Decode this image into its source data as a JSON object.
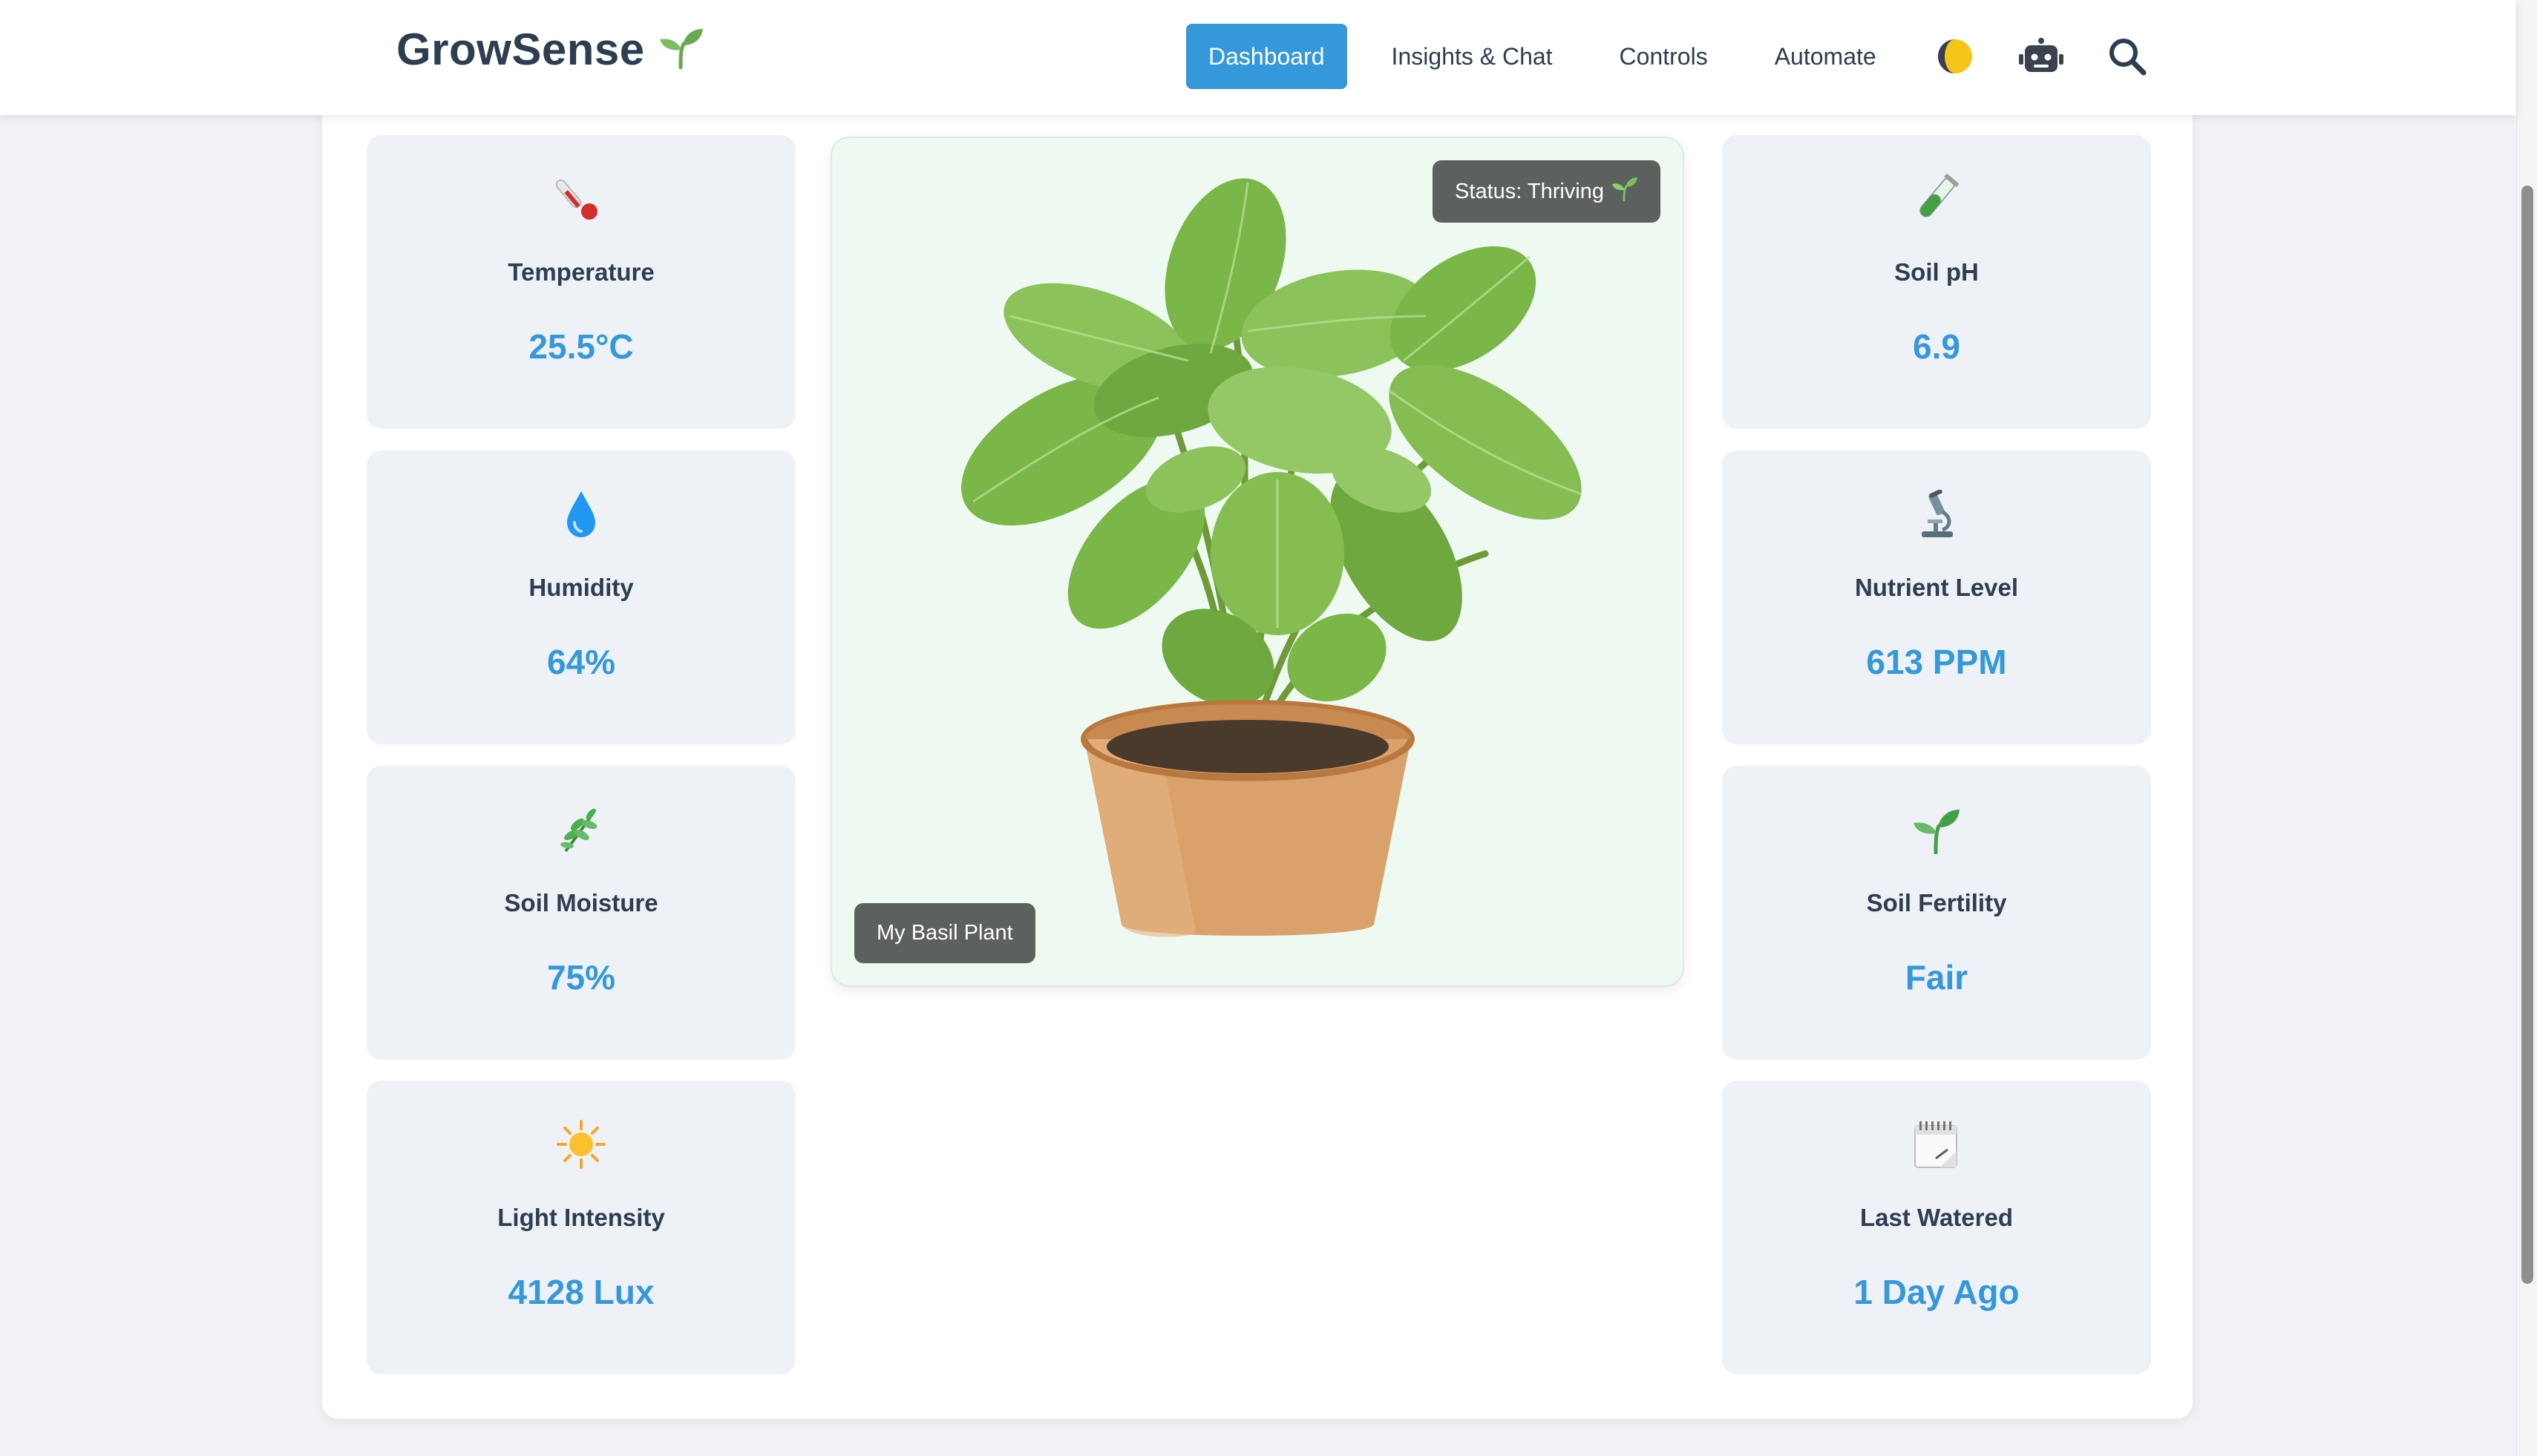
{
  "brand": {
    "name": "GrowSense"
  },
  "nav": {
    "items": [
      {
        "label": "Dashboard",
        "active": true
      },
      {
        "label": "Insights & Chat",
        "active": false
      },
      {
        "label": "Controls",
        "active": false
      },
      {
        "label": "Automate",
        "active": false
      }
    ],
    "icons": [
      "theme-toggle-icon",
      "robot-icon",
      "search-icon"
    ]
  },
  "sensors_left": [
    {
      "label": "Temperature",
      "value": "25.5°C",
      "icon": "thermometer-icon"
    },
    {
      "label": "Humidity",
      "value": "64%",
      "icon": "droplet-icon"
    },
    {
      "label": "Soil Moisture",
      "value": "75%",
      "icon": "herb-icon"
    },
    {
      "label": "Light Intensity",
      "value": "4128 Lux",
      "icon": "sun-icon"
    }
  ],
  "sensors_right": [
    {
      "label": "Soil pH",
      "value": "6.9",
      "icon": "test-tube-icon"
    },
    {
      "label": "Nutrient Level",
      "value": "613 PPM",
      "icon": "microscope-icon"
    },
    {
      "label": "Soil Fertility",
      "value": "Fair",
      "icon": "seedling-icon"
    },
    {
      "label": "Last Watered",
      "value": "1 Day Ago",
      "icon": "calendar-icon"
    }
  ],
  "plant": {
    "status": "Status: Thriving",
    "name": "My Basil Plant"
  },
  "colors": {
    "accent": "#3498db",
    "text": "#2c3e50",
    "card_bg": "#eef1f5",
    "plant_bg": "#eefaf1",
    "pill_bg": "#5c605e"
  }
}
